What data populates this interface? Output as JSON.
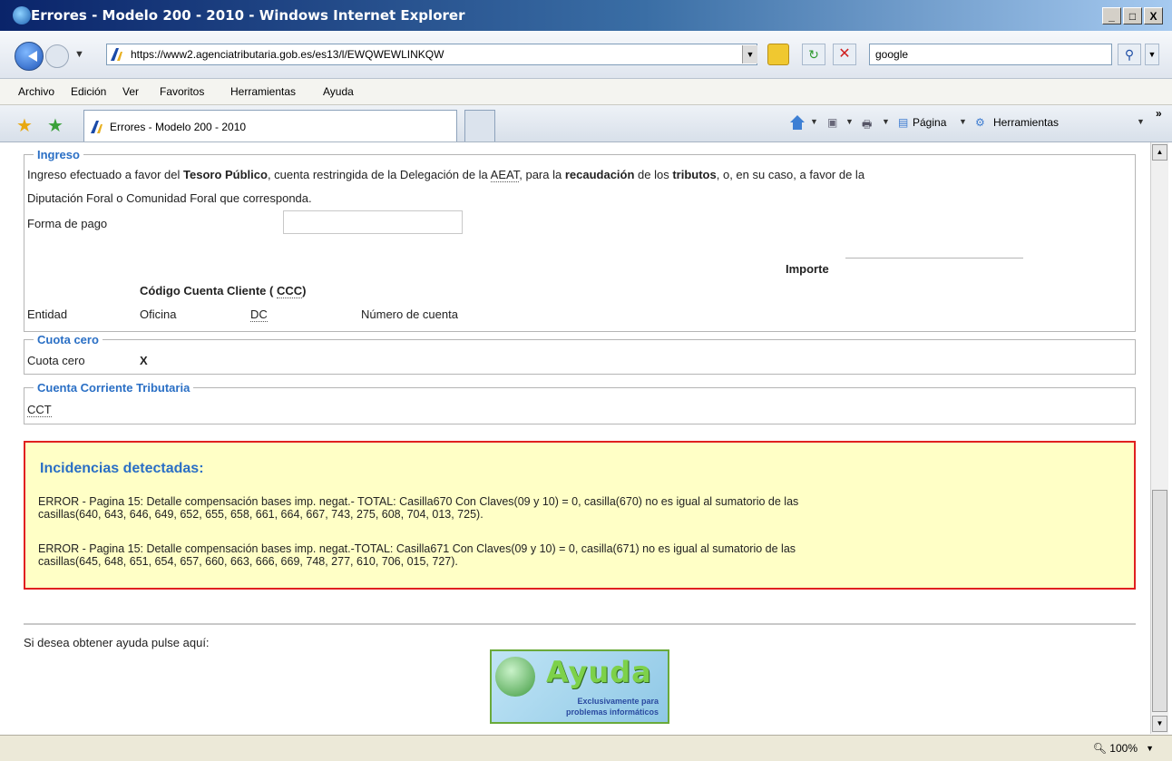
{
  "window": {
    "title": "Errores - Modelo 200 - 2010 - Windows Internet Explorer",
    "min": "_",
    "max": "□",
    "close": "X"
  },
  "address": {
    "url": "https://www2.agenciatributaria.gob.es/es13/l/EWQWEWLINKQW"
  },
  "search": {
    "value": "google"
  },
  "menu": [
    "Archivo",
    "Edición",
    "Ver",
    "Favoritos",
    "Herramientas",
    "Ayuda"
  ],
  "tab": {
    "label": "Errores - Modelo 200 - 2010"
  },
  "commands": {
    "page": "Página",
    "tools": "Herramientas"
  },
  "ingreso": {
    "legend": "Ingreso",
    "line1": {
      "p1": "Ingreso efectuado a favor del ",
      "b1": "Tesoro Público",
      "p2": ", cuenta restringida de la Delegación de la ",
      "aeat": "AEAT",
      "p3": ", para la ",
      "b2": "recaudación",
      "p4": " de los ",
      "b3": "tributos",
      "p5": ", o, en su caso, a favor de la"
    },
    "line2": "Diputación Foral o Comunidad Foral que corresponda.",
    "forma_pago_label": "Forma de pago",
    "forma_pago_value": "",
    "importe_label": "Importe",
    "ccc_title_prefix": "Código Cuenta Cliente ( ",
    "ccc_abbr": "CCC",
    "ccc_title_suffix": ")",
    "cols": {
      "entidad": "Entidad",
      "oficina": "Oficina",
      "dc": "DC",
      "numero": "Número de cuenta"
    }
  },
  "cuota_cero": {
    "legend": "Cuota cero",
    "label": "Cuota cero",
    "value": "X"
  },
  "cct": {
    "legend": "Cuenta Corriente Tributaria",
    "label": "CCT"
  },
  "incidencias": {
    "title": "Incidencias detectadas:",
    "errors": [
      {
        "line1": "ERROR - Pagina 15: Detalle compensación bases imp. negat.- TOTAL: Casilla670 Con Claves(09 y 10) = 0, casilla(670) no es igual al sumatorio de las",
        "line2": "casillas(640, 643, 646, 649, 652, 655, 658, 661, 664, 667, 743, 275, 608, 704, 013, 725)."
      },
      {
        "line1": "ERROR - Pagina 15: Detalle compensación bases imp. negat.-TOTAL: Casilla671 Con Claves(09 y 10) = 0, casilla(671) no es igual al sumatorio de las",
        "line2": "casillas(645, 648, 651, 654, 657, 660, 663, 666, 669, 748, 277, 610, 706, 015, 727)."
      }
    ]
  },
  "ayuda": {
    "prompt": "Si desea obtener ayuda pulse aquí:",
    "word": "Ayuda",
    "sub1": "Exclusivamente para",
    "sub2": "problemas informáticos"
  },
  "status": {
    "zoom": "100%"
  }
}
